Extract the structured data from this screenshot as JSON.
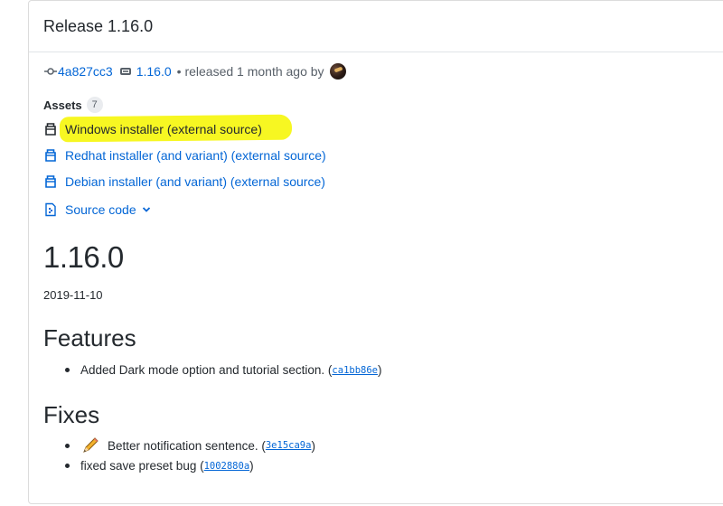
{
  "release": {
    "title": "Release 1.16.0",
    "commit": "4a827cc3",
    "tag": "1.16.0",
    "released_text": "• released 1 month ago by"
  },
  "assets": {
    "heading": "Assets",
    "count": "7",
    "items": [
      {
        "label": "Windows installer (external source)",
        "icon": "package-icon",
        "highlighted": true
      },
      {
        "label": "Redhat installer (and variant) (external source)",
        "icon": "package-icon"
      },
      {
        "label": "Debian installer (and variant) (external source)",
        "icon": "package-icon"
      },
      {
        "label": "Source code",
        "icon": "file-zip-icon"
      }
    ]
  },
  "body": {
    "version": "1.16.0",
    "date": "2019-11-10",
    "features_heading": "Features",
    "features": [
      {
        "text": "Added Dark mode option and tutorial section. (",
        "sha": "ca1bb86e",
        "close": ")"
      }
    ],
    "fixes_heading": "Fixes",
    "fixes": [
      {
        "text": "Better notification sentence. (",
        "sha": "3e15ca9a",
        "close": ")",
        "icon": "pencil-icon"
      },
      {
        "text": "fixed save preset bug (",
        "sha": "1002880a",
        "close": ")"
      }
    ]
  },
  "colors": {
    "link": "#0366d6",
    "highlight": "#f7f722",
    "text": "#24292e"
  }
}
